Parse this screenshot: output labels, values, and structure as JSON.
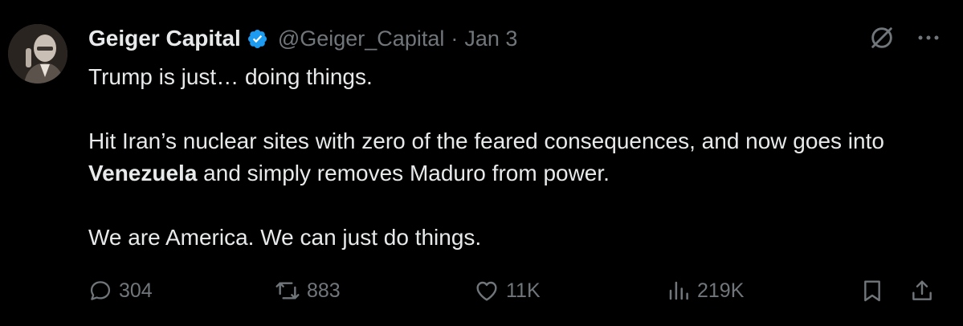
{
  "author": {
    "name": "Geiger Capital",
    "handle": "@Geiger_Capital",
    "verified_icon": "verified-badge-icon",
    "avatar_icon": "avatar-photo"
  },
  "meta": {
    "separator": "·",
    "date": "Jan 3"
  },
  "tweet": {
    "line1": "Trump is just… doing things.",
    "para2_part1": "Hit Iran’s nuclear sites with zero of the feared consequences, and now goes into ",
    "para2_bold": "Venezuela",
    "para2_part2": " and simply removes Maduro from power.",
    "para3": "We are America. We can just do things."
  },
  "stats": {
    "replies": "304",
    "reposts": "883",
    "likes": "11K",
    "views": "219K"
  },
  "icons": {
    "top_right": [
      "grok-icon",
      "more-icon"
    ],
    "actions": [
      "reply-icon",
      "repost-icon",
      "like-icon",
      "views-icon",
      "bookmark-icon",
      "share-icon"
    ]
  },
  "colors": {
    "background": "#000000",
    "text": "#e7e9ea",
    "muted": "#71767b",
    "verified": "#1d9bf0"
  }
}
